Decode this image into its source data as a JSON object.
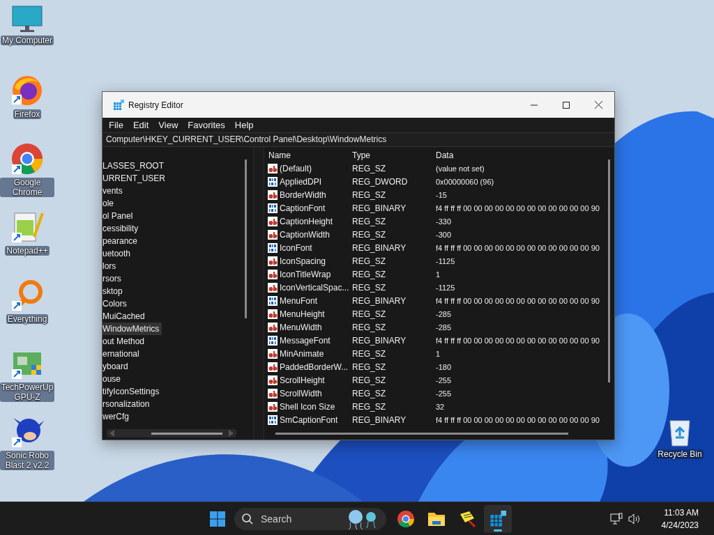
{
  "desktop_icons": [
    {
      "label": "My Computer",
      "kind": "computer"
    },
    {
      "label": "Firefox",
      "kind": "firefox"
    },
    {
      "label": "Google Chrome",
      "kind": "chrome"
    },
    {
      "label": "Notepad++",
      "kind": "notepad"
    },
    {
      "label": "Everything",
      "kind": "everything"
    },
    {
      "label": "TechPowerUp GPU-Z",
      "kind": "gpu"
    },
    {
      "label": "Sonic Robo Blast 2 v2.2",
      "kind": "game"
    }
  ],
  "recycle_bin": {
    "label": "Recycle Bin"
  },
  "window": {
    "title": "Registry Editor",
    "menu": [
      "File",
      "Edit",
      "View",
      "Favorites",
      "Help"
    ],
    "address": "Computer\\HKEY_CURRENT_USER\\Control Panel\\Desktop\\WindowMetrics",
    "tree": [
      {
        "label": "LASSES_ROOT",
        "selected": false
      },
      {
        "label": "URRENT_USER",
        "selected": false
      },
      {
        "label": "vents",
        "selected": false
      },
      {
        "label": "ole",
        "selected": false
      },
      {
        "label": "ol Panel",
        "selected": false
      },
      {
        "label": "cessibility",
        "selected": false
      },
      {
        "label": "pearance",
        "selected": false
      },
      {
        "label": "uetooth",
        "selected": false
      },
      {
        "label": "lors",
        "selected": false
      },
      {
        "label": "rsors",
        "selected": false
      },
      {
        "label": "sktop",
        "selected": false
      },
      {
        "label": "Colors",
        "selected": false
      },
      {
        "label": "MuiCached",
        "selected": false
      },
      {
        "label": "WindowMetrics",
        "selected": true
      },
      {
        "label": "out Method",
        "selected": false
      },
      {
        "label": "ernational",
        "selected": false
      },
      {
        "label": "yboard",
        "selected": false
      },
      {
        "label": "ouse",
        "selected": false
      },
      {
        "label": "tifyIconSettings",
        "selected": false
      },
      {
        "label": "rsonalization",
        "selected": false
      },
      {
        "label": "werCfg",
        "selected": false
      }
    ],
    "columns": [
      "Name",
      "Type",
      "Data"
    ],
    "rows": [
      {
        "kind": "string",
        "name": "(Default)",
        "type": "REG_SZ",
        "data": "(value not set)"
      },
      {
        "kind": "binary",
        "name": "AppliedDPI",
        "type": "REG_DWORD",
        "data": "0x00000060 (96)"
      },
      {
        "kind": "string",
        "name": "BorderWidth",
        "type": "REG_SZ",
        "data": "-15"
      },
      {
        "kind": "binary",
        "name": "CaptionFont",
        "type": "REG_BINARY",
        "data": "f4 ff ff ff 00 00 00 00 00 00 00 00 00 00 00 00 90"
      },
      {
        "kind": "string",
        "name": "CaptionHeight",
        "type": "REG_SZ",
        "data": "-330"
      },
      {
        "kind": "string",
        "name": "CaptionWidth",
        "type": "REG_SZ",
        "data": "-300"
      },
      {
        "kind": "binary",
        "name": "IconFont",
        "type": "REG_BINARY",
        "data": "f4 ff ff ff 00 00 00 00 00 00 00 00 00 00 00 00 90"
      },
      {
        "kind": "string",
        "name": "IconSpacing",
        "type": "REG_SZ",
        "data": "-1125"
      },
      {
        "kind": "string",
        "name": "IconTitleWrap",
        "type": "REG_SZ",
        "data": "1"
      },
      {
        "kind": "string",
        "name": "IconVerticalSpac...",
        "type": "REG_SZ",
        "data": "-1125"
      },
      {
        "kind": "binary",
        "name": "MenuFont",
        "type": "REG_BINARY",
        "data": "f4 ff ff ff 00 00 00 00 00 00 00 00 00 00 00 00 90"
      },
      {
        "kind": "string",
        "name": "MenuHeight",
        "type": "REG_SZ",
        "data": "-285"
      },
      {
        "kind": "string",
        "name": "MenuWidth",
        "type": "REG_SZ",
        "data": "-285"
      },
      {
        "kind": "binary",
        "name": "MessageFont",
        "type": "REG_BINARY",
        "data": "f4 ff ff ff 00 00 00 00 00 00 00 00 00 00 00 00 90"
      },
      {
        "kind": "string",
        "name": "MinAnimate",
        "type": "REG_SZ",
        "data": "1"
      },
      {
        "kind": "string",
        "name": "PaddedBorderW...",
        "type": "REG_SZ",
        "data": "-180"
      },
      {
        "kind": "string",
        "name": "ScrollHeight",
        "type": "REG_SZ",
        "data": "-255"
      },
      {
        "kind": "string",
        "name": "ScrollWidth",
        "type": "REG_SZ",
        "data": "-255"
      },
      {
        "kind": "string",
        "name": "Shell Icon Size",
        "type": "REG_SZ",
        "data": "32"
      },
      {
        "kind": "binary",
        "name": "SmCaptionFont",
        "type": "REG_BINARY",
        "data": "f4 ff ff ff 00 00 00 00 00 00 00 00 00 00 00 00 90"
      }
    ]
  },
  "taskbar": {
    "search": {
      "placeholder": "Search"
    },
    "apps": [
      {
        "kind": "chrome",
        "active": false
      },
      {
        "kind": "explorer",
        "active": false
      },
      {
        "kind": "tool",
        "active": false
      },
      {
        "kind": "regedit",
        "active": true
      }
    ],
    "time": "11:03 AM",
    "date": "4/24/2023"
  }
}
